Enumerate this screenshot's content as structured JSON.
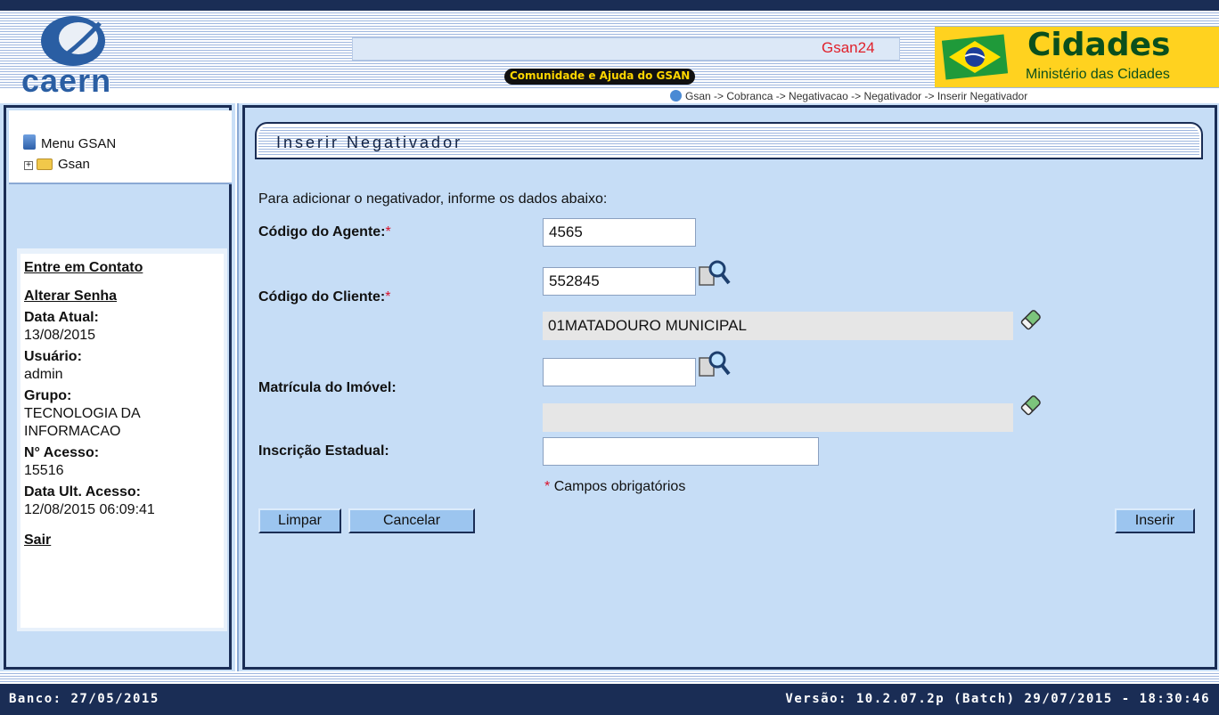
{
  "header": {
    "logo_text": "caern",
    "system_tag": "Gsan24",
    "help_link": "Comunidade e Ajuda do GSAN",
    "ministry_title": "Cidades",
    "ministry_subtitle": "Ministério das Cidades",
    "breadcrumb": "Gsan -> Cobranca -> Negativacao -> Negativador -> Inserir Negativador"
  },
  "sidebar": {
    "menu_title": "Menu GSAN",
    "tree_root": "Gsan",
    "links": {
      "contact": "Entre em Contato",
      "change_password": "Alterar Senha",
      "logout": "Sair"
    },
    "info": {
      "date_label": "Data Atual:",
      "date_value": "13/08/2015",
      "user_label": "Usuário:",
      "user_value": "admin",
      "group_label": "Grupo:",
      "group_value_line1": "TECNOLOGIA DA",
      "group_value_line2": "INFORMACAO",
      "access_label": "N° Acesso:",
      "access_value": "15516",
      "last_access_label": "Data Ult. Acesso:",
      "last_access_value": "12/08/2015 06:09:41"
    }
  },
  "form": {
    "title": "Inserir Negativador",
    "intro": "Para adicionar o negativador, informe os dados abaixo:",
    "agent_code": {
      "label": "Código do Agente:",
      "value": "4565"
    },
    "client_code": {
      "label": "Código do Cliente:",
      "value": "552845",
      "description": "01MATADOURO MUNICIPAL"
    },
    "property_registration": {
      "label": "Matrícula do Imóvel:",
      "value": "",
      "description": ""
    },
    "state_registration": {
      "label": "Inscrição Estadual:",
      "value": ""
    },
    "required_marker": "*",
    "required_note": "Campos obrigatórios",
    "buttons": {
      "clear": "Limpar",
      "cancel": "Cancelar",
      "insert": "Inserir"
    }
  },
  "footer": {
    "bank": "Banco: 27/05/2015",
    "version": "Versão: 10.2.07.2p (Batch) 29/07/2015 - 18:30:46"
  },
  "colors": {
    "navy": "#1a2d55",
    "panel_blue": "#c6ddf6",
    "required_red": "#d9112a",
    "ministry_yellow": "#ffd21f"
  }
}
